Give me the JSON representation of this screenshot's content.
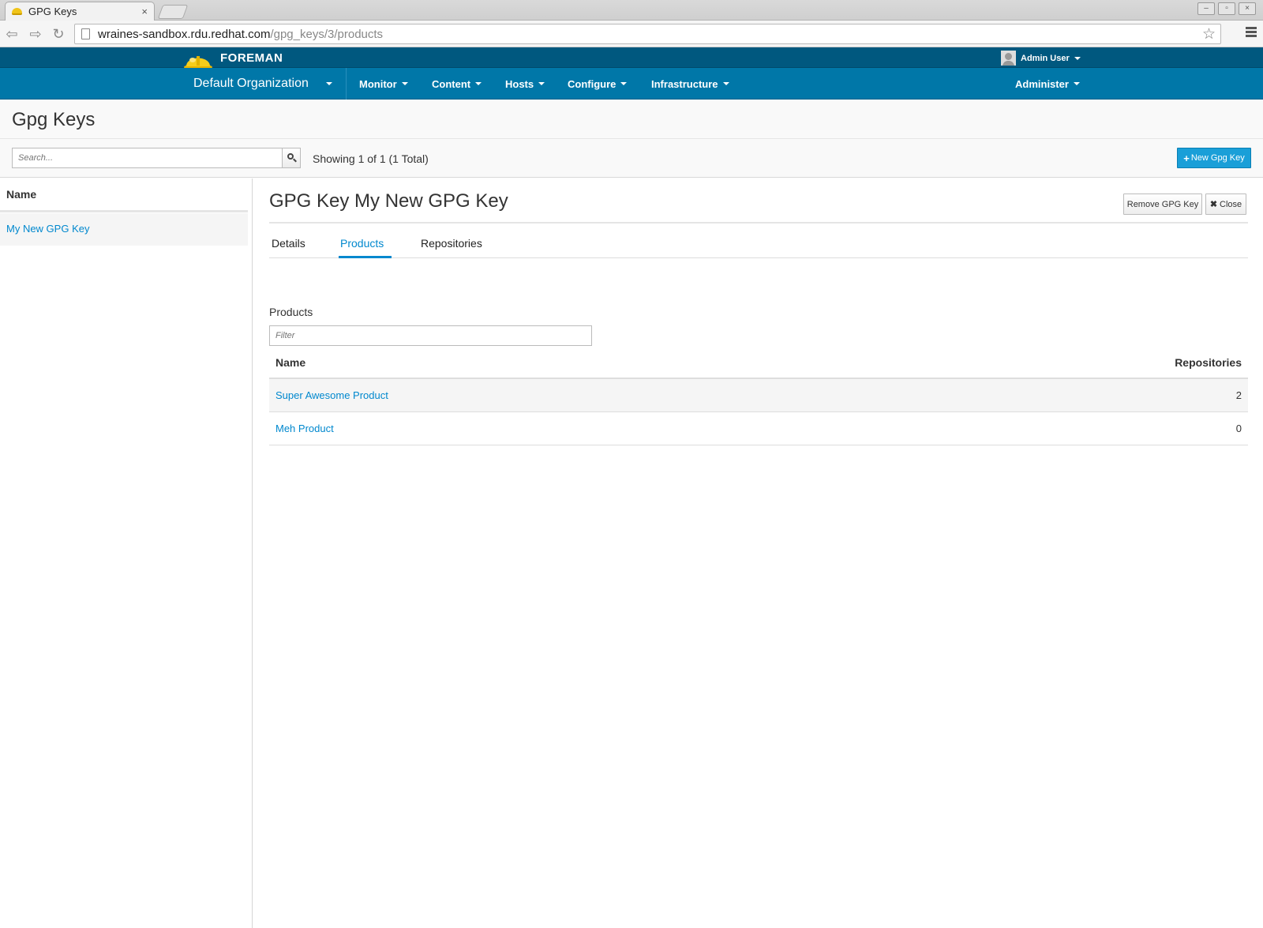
{
  "browser": {
    "tab_title": "GPG Keys",
    "tab_close": "×",
    "url_host": "wraines-sandbox.rdu.redhat.com",
    "url_path": "/gpg_keys/3/products",
    "star": "☆"
  },
  "brand": {
    "name": "FOREMAN"
  },
  "user": {
    "name": "Admin User"
  },
  "nav": {
    "organization": "Default Organization",
    "items": [
      "Monitor",
      "Content",
      "Hosts",
      "Configure",
      "Infrastructure"
    ],
    "administer": "Administer"
  },
  "page": {
    "title": "Gpg Keys",
    "search_placeholder": "Search...",
    "showing": "Showing 1 of 1 (1 Total)",
    "new_button": "New Gpg Key"
  },
  "list": {
    "header": "Name",
    "items": [
      "My New GPG Key"
    ]
  },
  "detail": {
    "title": "GPG Key My New GPG Key",
    "remove_button": "Remove GPG Key",
    "close_button": "Close",
    "tabs": [
      "Details",
      "Products",
      "Repositories"
    ],
    "active_tab": "Products",
    "section_label": "Products",
    "filter_placeholder": "Filter",
    "columns": [
      "Name",
      "Repositories"
    ],
    "products": [
      {
        "name": "Super Awesome Product",
        "repositories": "2"
      },
      {
        "name": "Meh Product",
        "repositories": "0"
      }
    ]
  },
  "colors": {
    "brand_dark": "#00587f",
    "brand_nav": "#0077a8",
    "link": "#0088ce",
    "primary_button": "#1a9fd8"
  }
}
